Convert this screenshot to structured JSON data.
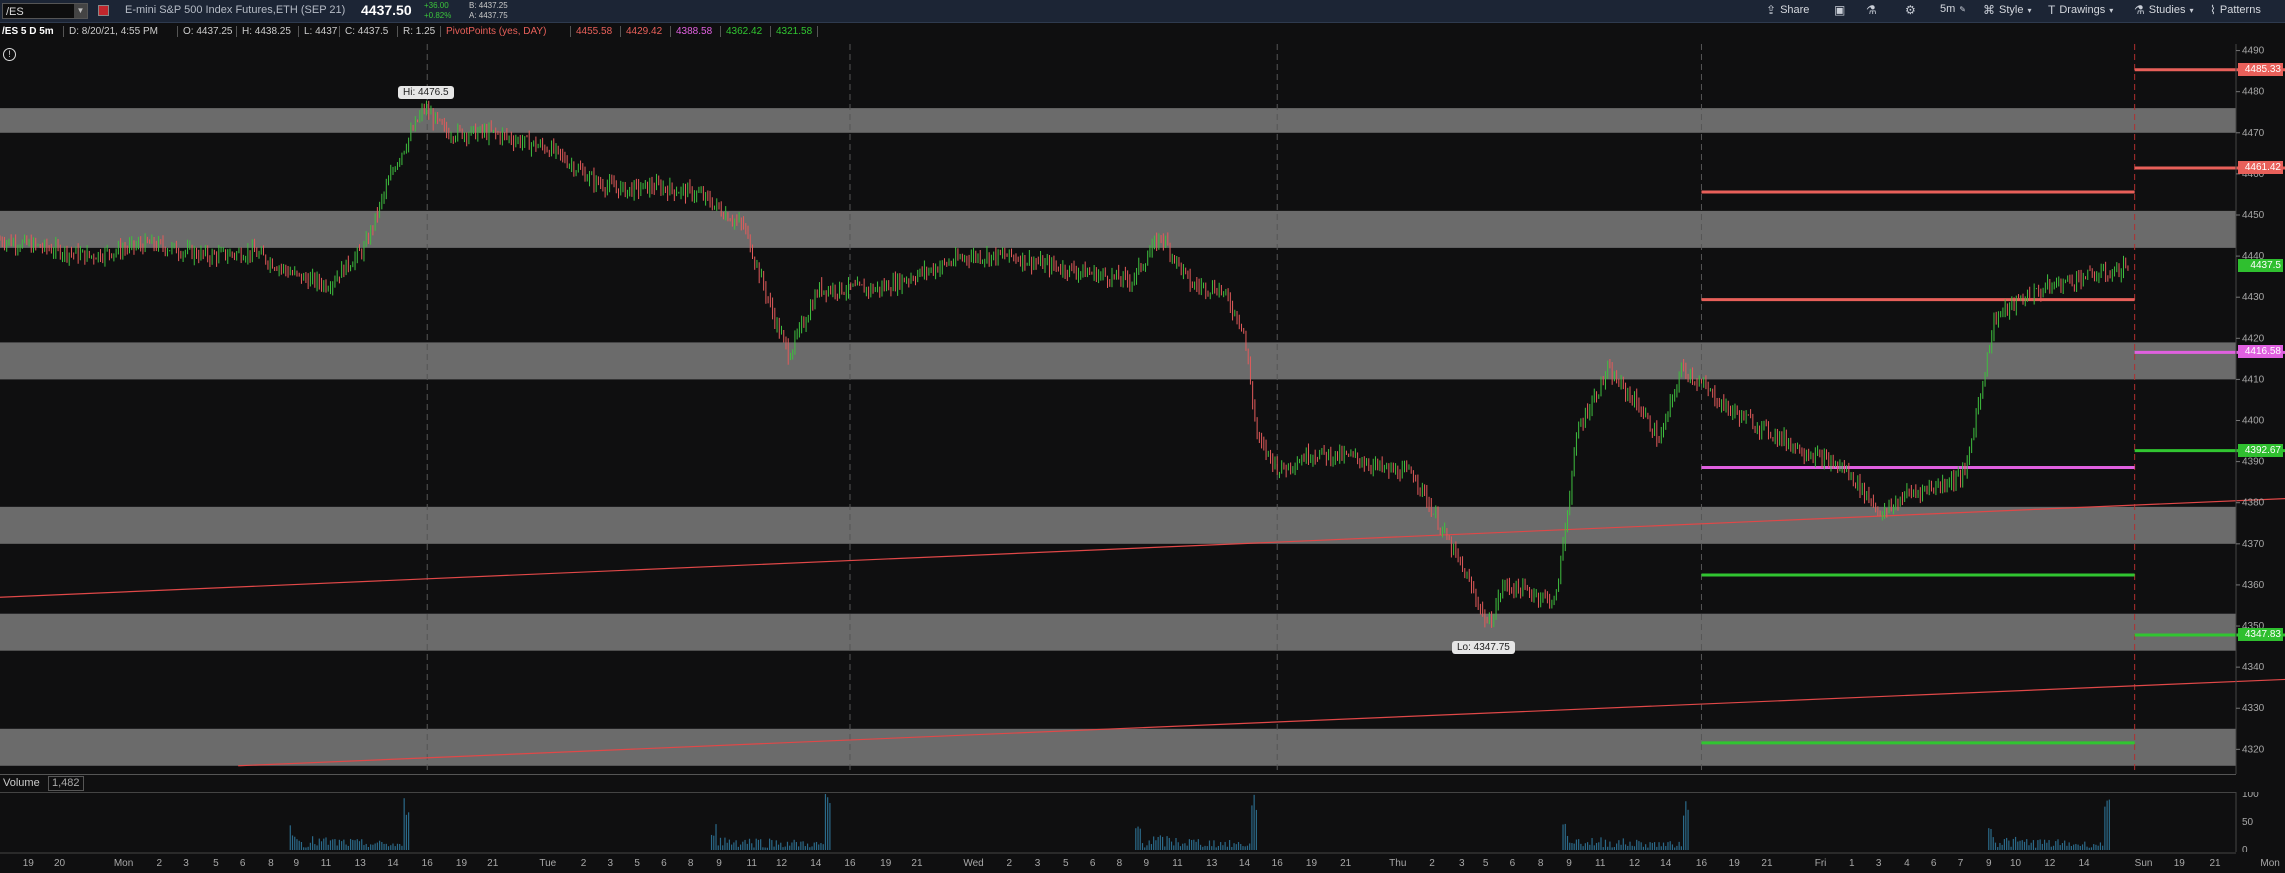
{
  "toolbar": {
    "symbol": "/ES",
    "title": "E-mini S&P 500 Index Futures,ETH (SEP 21)",
    "last_price": "4437.50",
    "change": "+36.00",
    "change_pct": "+0.82%",
    "bid": "B: 4437.25",
    "ask": "A: 4437.75",
    "share": "Share",
    "period": "5m",
    "style": "Style",
    "drawings": "Drawings",
    "studies": "Studies",
    "patterns": "Patterns"
  },
  "info": {
    "label": "/ES 5 D 5m",
    "date": "D: 8/20/21, 4:55 PM",
    "open": "O: 4437.25",
    "high": "H: 4438.25",
    "low": "L: 4437",
    "close": "C: 4437.5",
    "range": "R: 1.25",
    "pivot_study": "PivotPoints (yes, DAY)",
    "pivots": [
      "4455.58",
      "4429.42",
      "4388.58",
      "4362.42",
      "4321.58"
    ],
    "pivot_colors": [
      "#e8605a",
      "#e8605a",
      "#e060e0",
      "#31c531",
      "#31c531"
    ]
  },
  "chart_data": {
    "type": "candlestick",
    "y_ticks": [
      4320,
      4330,
      4340,
      4350,
      4360,
      4370,
      4380,
      4390,
      4400,
      4410,
      4420,
      4430,
      4440,
      4450,
      4460,
      4470,
      4480,
      4490
    ],
    "ylim": [
      4315,
      4494
    ],
    "hi_label": "Hi: 4476.5",
    "lo_label": "Lo: 4347.75",
    "price_tags": [
      {
        "value": "4485.33",
        "price": 4485.33,
        "color": "#e8605a"
      },
      {
        "value": "4461.42",
        "price": 4461.42,
        "color": "#e8605a"
      },
      {
        "value": "4437.5",
        "price": 4437.5,
        "color": "#2fbf2f"
      },
      {
        "value": "4416.58",
        "price": 4416.58,
        "color": "#e060e0"
      },
      {
        "value": "4392.67",
        "price": 4392.67,
        "color": "#2fbf2f"
      },
      {
        "value": "4347.83",
        "price": 4347.83,
        "color": "#2fbf2f"
      }
    ],
    "gray_zones": [
      [
        4470,
        4476
      ],
      [
        4442,
        4451
      ],
      [
        4410,
        4419
      ],
      [
        4370,
        4379
      ],
      [
        4344,
        4353
      ],
      [
        4316,
        4325
      ]
    ],
    "pivot_current": [
      {
        "price": 4455.58,
        "color": "#e8605a"
      },
      {
        "price": 4429.42,
        "color": "#e8605a"
      },
      {
        "price": 4388.58,
        "color": "#e060e0"
      },
      {
        "price": 4362.42,
        "color": "#31c531"
      },
      {
        "price": 4321.58,
        "color": "#31c531"
      }
    ],
    "pivot_next": [
      {
        "price": 4485.33,
        "color": "#e8605a"
      },
      {
        "price": 4461.42,
        "color": "#e8605a"
      },
      {
        "price": 4416.58,
        "color": "#e060e0"
      },
      {
        "price": 4392.67,
        "color": "#31c531"
      },
      {
        "price": 4347.83,
        "color": "#31c531"
      }
    ],
    "price_path": [
      [
        0,
        4444
      ],
      [
        30,
        4442
      ],
      [
        60,
        4440
      ],
      [
        100,
        4443
      ],
      [
        140,
        4440
      ],
      [
        170,
        4441
      ],
      [
        200,
        4435
      ],
      [
        220,
        4433
      ],
      [
        245,
        4442
      ],
      [
        265,
        4462
      ],
      [
        285,
        4476
      ],
      [
        300,
        4470
      ],
      [
        330,
        4470
      ],
      [
        370,
        4466
      ],
      [
        400,
        4458
      ],
      [
        420,
        4456
      ],
      [
        440,
        4457
      ],
      [
        470,
        4455
      ],
      [
        500,
        4447
      ],
      [
        520,
        4425
      ],
      [
        530,
        4416
      ],
      [
        550,
        4432
      ],
      [
        590,
        4432
      ],
      [
        620,
        4436
      ],
      [
        650,
        4440
      ],
      [
        680,
        4440
      ],
      [
        700,
        4438
      ],
      [
        730,
        4436
      ],
      [
        760,
        4434
      ],
      [
        780,
        4445
      ],
      [
        800,
        4433
      ],
      [
        820,
        4432
      ],
      [
        835,
        4423
      ],
      [
        845,
        4395
      ],
      [
        860,
        4388
      ],
      [
        880,
        4392
      ],
      [
        910,
        4391
      ],
      [
        930,
        4388
      ],
      [
        950,
        4387
      ],
      [
        965,
        4376
      ],
      [
        985,
        4362
      ],
      [
        1000,
        4350
      ],
      [
        1010,
        4360
      ],
      [
        1030,
        4358
      ],
      [
        1045,
        4356
      ],
      [
        1060,
        4398
      ],
      [
        1080,
        4412
      ],
      [
        1100,
        4404
      ],
      [
        1115,
        4395
      ],
      [
        1130,
        4413
      ],
      [
        1160,
        4403
      ],
      [
        1185,
        4398
      ],
      [
        1210,
        4393
      ],
      [
        1240,
        4388
      ],
      [
        1265,
        4377
      ],
      [
        1280,
        4382
      ],
      [
        1300,
        4384
      ],
      [
        1320,
        4387
      ],
      [
        1340,
        4425
      ],
      [
        1360,
        4430
      ],
      [
        1380,
        4433
      ],
      [
        1400,
        4435
      ],
      [
        1420,
        4436
      ],
      [
        1430,
        4438
      ]
    ],
    "trend_lines": [
      {
        "x1": 0,
        "p1": 4357,
        "x2": 1535,
        "p2": 4381,
        "color": "#e04848"
      },
      {
        "x1": 160,
        "p1": 4316,
        "x2": 1535,
        "p2": 4337,
        "color": "#e04848"
      }
    ],
    "dashed_vlines": [
      287,
      571,
      858,
      1143,
      1434
    ],
    "x_ticks": [
      {
        "x": 19,
        "label": "19"
      },
      {
        "x": 40,
        "label": "20"
      },
      {
        "x": 83,
        "label": "Mon"
      },
      {
        "x": 107,
        "label": "2"
      },
      {
        "x": 125,
        "label": "3"
      },
      {
        "x": 145,
        "label": "5"
      },
      {
        "x": 163,
        "label": "6"
      },
      {
        "x": 182,
        "label": "8"
      },
      {
        "x": 199,
        "label": "9"
      },
      {
        "x": 219,
        "label": "11"
      },
      {
        "x": 242,
        "label": "13"
      },
      {
        "x": 264,
        "label": "14"
      },
      {
        "x": 287,
        "label": "16"
      },
      {
        "x": 310,
        "label": "19"
      },
      {
        "x": 331,
        "label": "21"
      },
      {
        "x": 368,
        "label": "Tue"
      },
      {
        "x": 392,
        "label": "2"
      },
      {
        "x": 410,
        "label": "3"
      },
      {
        "x": 428,
        "label": "5"
      },
      {
        "x": 446,
        "label": "6"
      },
      {
        "x": 464,
        "label": "8"
      },
      {
        "x": 483,
        "label": "9"
      },
      {
        "x": 505,
        "label": "11"
      },
      {
        "x": 525,
        "label": "12"
      },
      {
        "x": 548,
        "label": "14"
      },
      {
        "x": 571,
        "label": "16"
      },
      {
        "x": 595,
        "label": "19"
      },
      {
        "x": 616,
        "label": "21"
      },
      {
        "x": 654,
        "label": "Wed"
      },
      {
        "x": 678,
        "label": "2"
      },
      {
        "x": 697,
        "label": "3"
      },
      {
        "x": 716,
        "label": "5"
      },
      {
        "x": 734,
        "label": "6"
      },
      {
        "x": 752,
        "label": "8"
      },
      {
        "x": 770,
        "label": "9"
      },
      {
        "x": 791,
        "label": "11"
      },
      {
        "x": 814,
        "label": "13"
      },
      {
        "x": 836,
        "label": "14"
      },
      {
        "x": 858,
        "label": "16"
      },
      {
        "x": 881,
        "label": "19"
      },
      {
        "x": 904,
        "label": "21"
      },
      {
        "x": 939,
        "label": "Thu"
      },
      {
        "x": 962,
        "label": "2"
      },
      {
        "x": 982,
        "label": "3"
      },
      {
        "x": 998,
        "label": "5"
      },
      {
        "x": 1016,
        "label": "6"
      },
      {
        "x": 1035,
        "label": "8"
      },
      {
        "x": 1054,
        "label": "9"
      },
      {
        "x": 1075,
        "label": "11"
      },
      {
        "x": 1098,
        "label": "12"
      },
      {
        "x": 1119,
        "label": "14"
      },
      {
        "x": 1143,
        "label": "16"
      },
      {
        "x": 1165,
        "label": "19"
      },
      {
        "x": 1187,
        "label": "21"
      },
      {
        "x": 1223,
        "label": "Fri"
      },
      {
        "x": 1244,
        "label": "1"
      },
      {
        "x": 1262,
        "label": "3"
      },
      {
        "x": 1281,
        "label": "4"
      },
      {
        "x": 1299,
        "label": "6"
      },
      {
        "x": 1317,
        "label": "7"
      },
      {
        "x": 1336,
        "label": "9"
      },
      {
        "x": 1354,
        "label": "10"
      },
      {
        "x": 1377,
        "label": "12"
      },
      {
        "x": 1400,
        "label": "14"
      },
      {
        "x": 1440,
        "label": "Sun"
      },
      {
        "x": 1464,
        "label": "19"
      },
      {
        "x": 1488,
        "label": "21"
      },
      {
        "x": 1525,
        "label": "Mon"
      }
    ],
    "volume": {
      "label": "Volume",
      "value": "1,482",
      "ticks": [
        {
          "v": 100,
          "label": "100"
        },
        {
          "v": 50,
          "label": "50"
        },
        {
          "v": 0,
          "label": "0"
        }
      ],
      "clusters": [
        [
          195,
          275,
          24
        ],
        [
          478,
          558,
          26
        ],
        [
          763,
          845,
          26
        ],
        [
          1050,
          1135,
          24
        ],
        [
          1336,
          1418,
          23
        ]
      ]
    }
  }
}
